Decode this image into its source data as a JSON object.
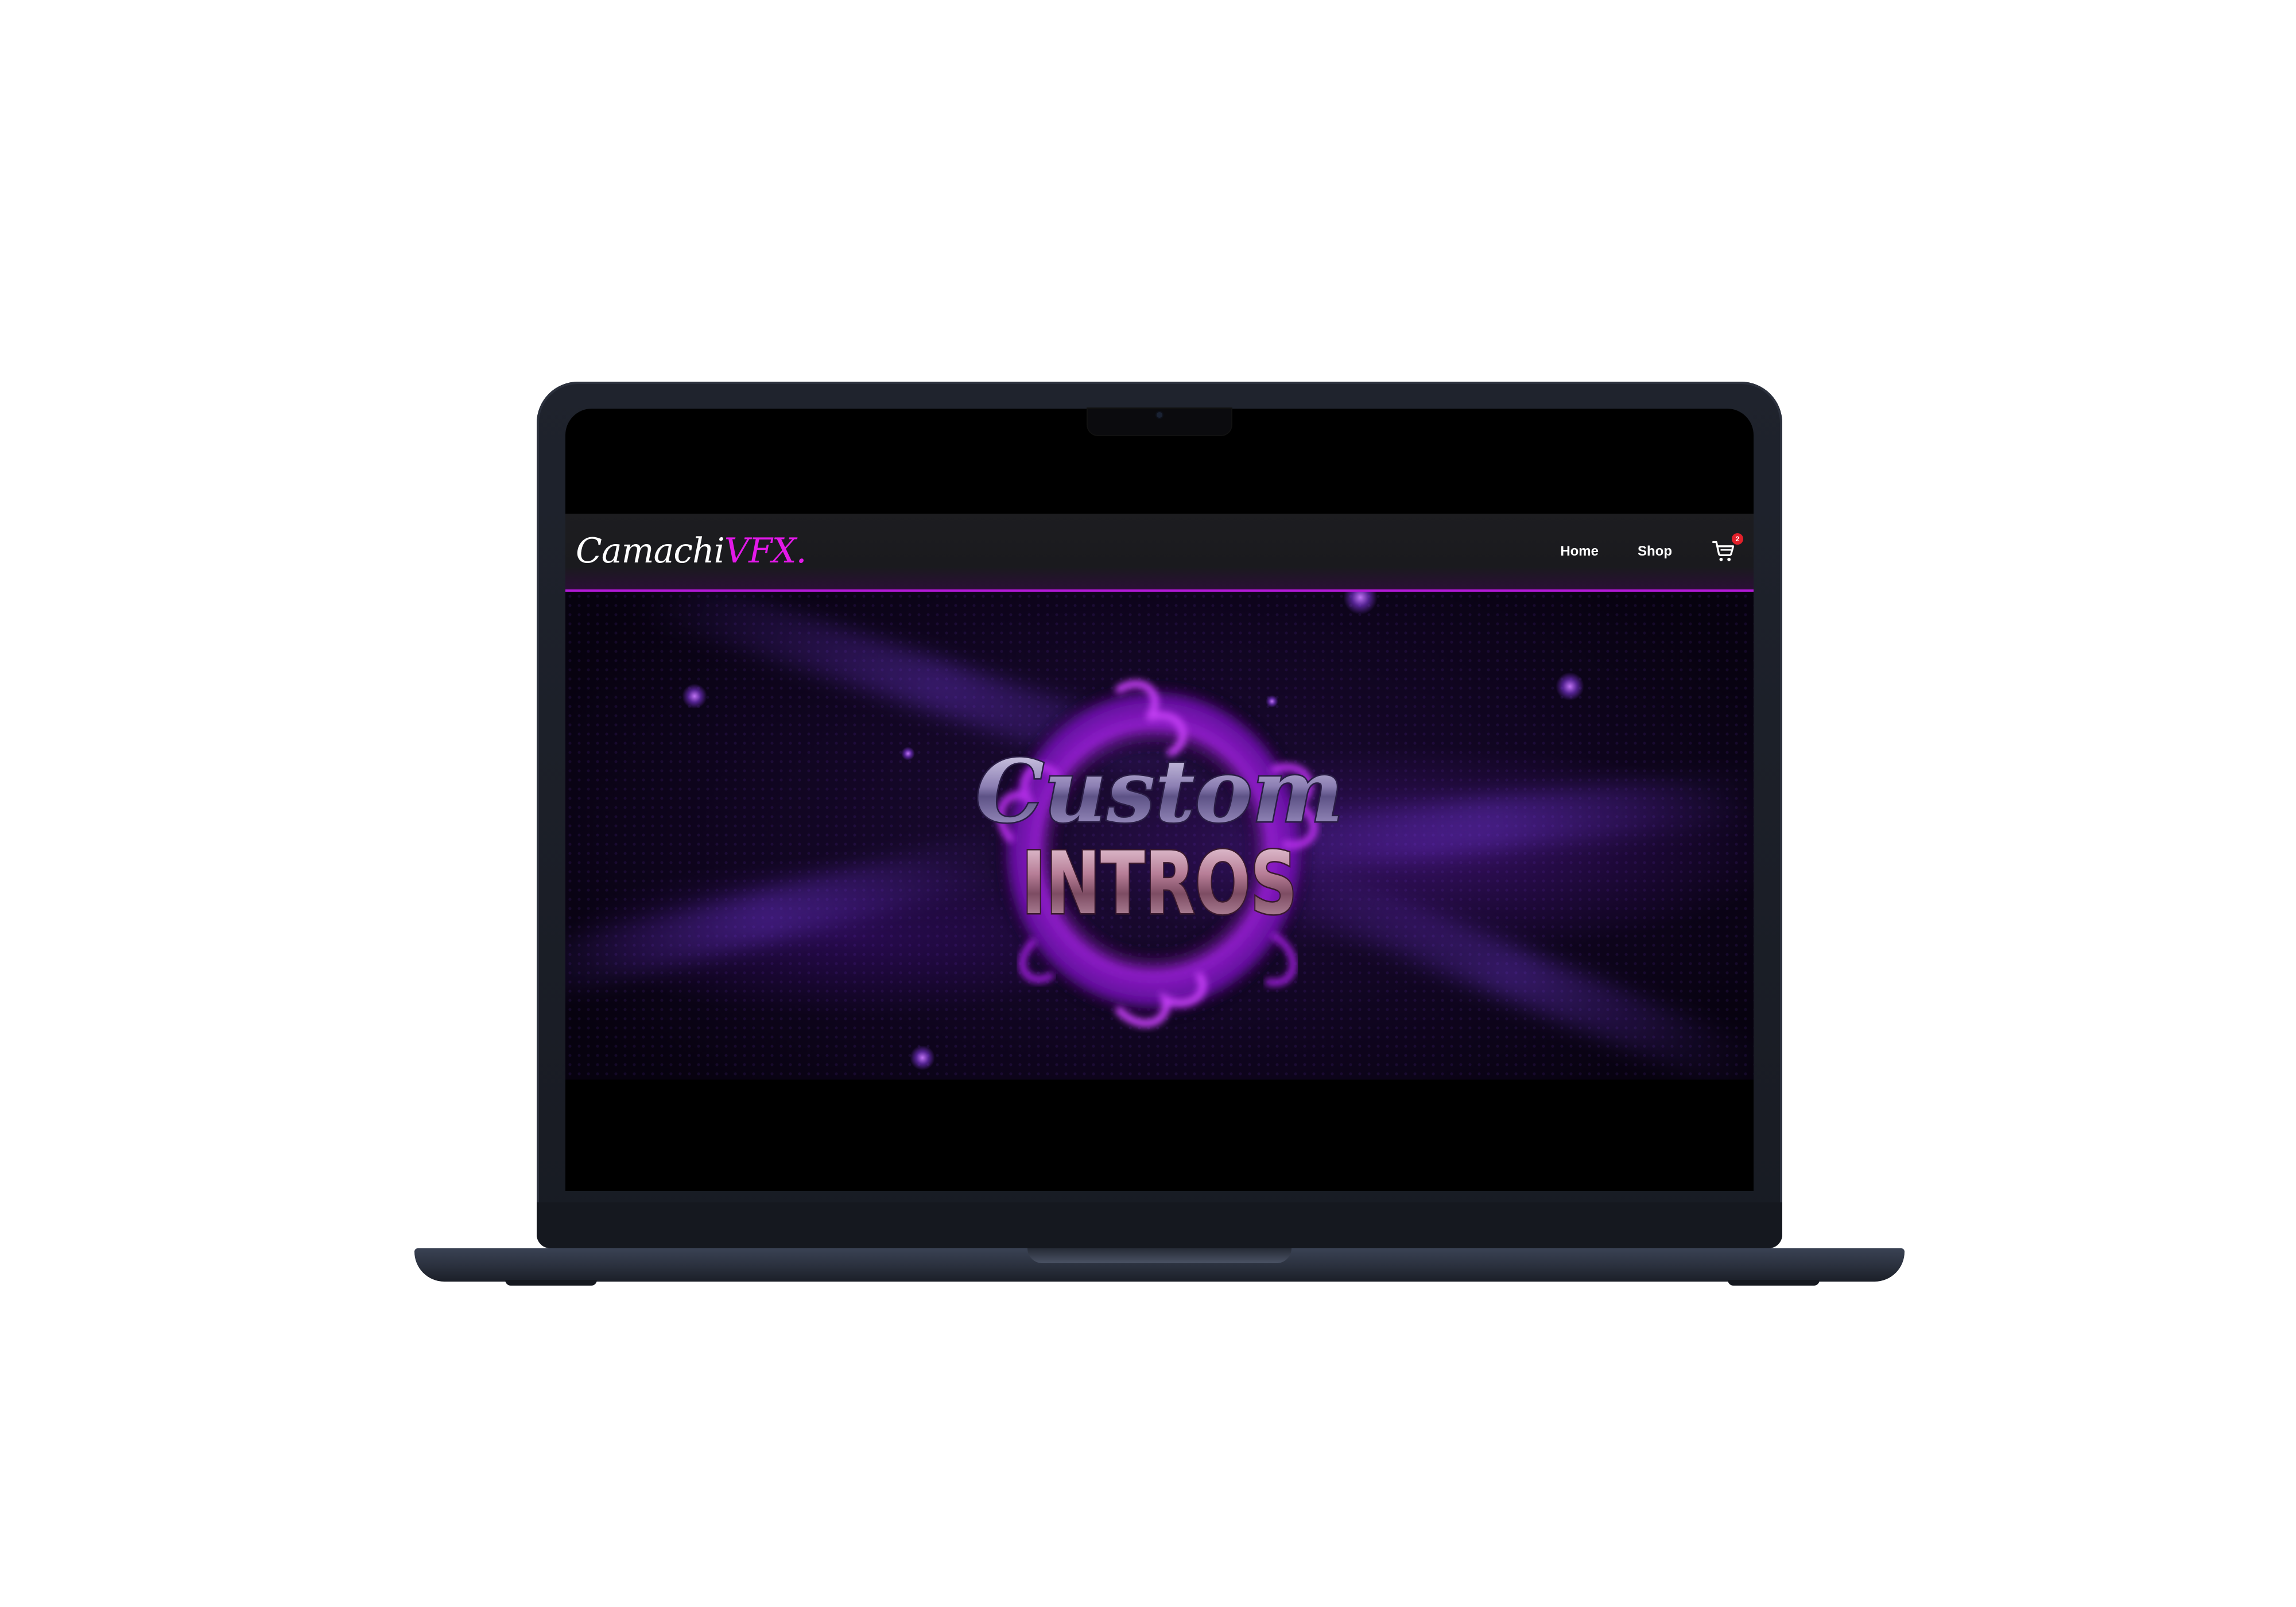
{
  "site": {
    "logo_part1": "Camachi",
    "logo_part2": "VFX."
  },
  "nav": {
    "links": [
      {
        "label": "Home"
      },
      {
        "label": "Shop"
      }
    ],
    "cart_count": "2"
  },
  "hero": {
    "title_line1": "Custom",
    "title_line2": "INTROS"
  },
  "colors": {
    "accent": "#e319e9",
    "navbar_bg": "#1d1d20",
    "hero_bg": "#100520",
    "badge": "#e3202a"
  },
  "icons": {
    "cart": "shopping-cart-icon"
  }
}
